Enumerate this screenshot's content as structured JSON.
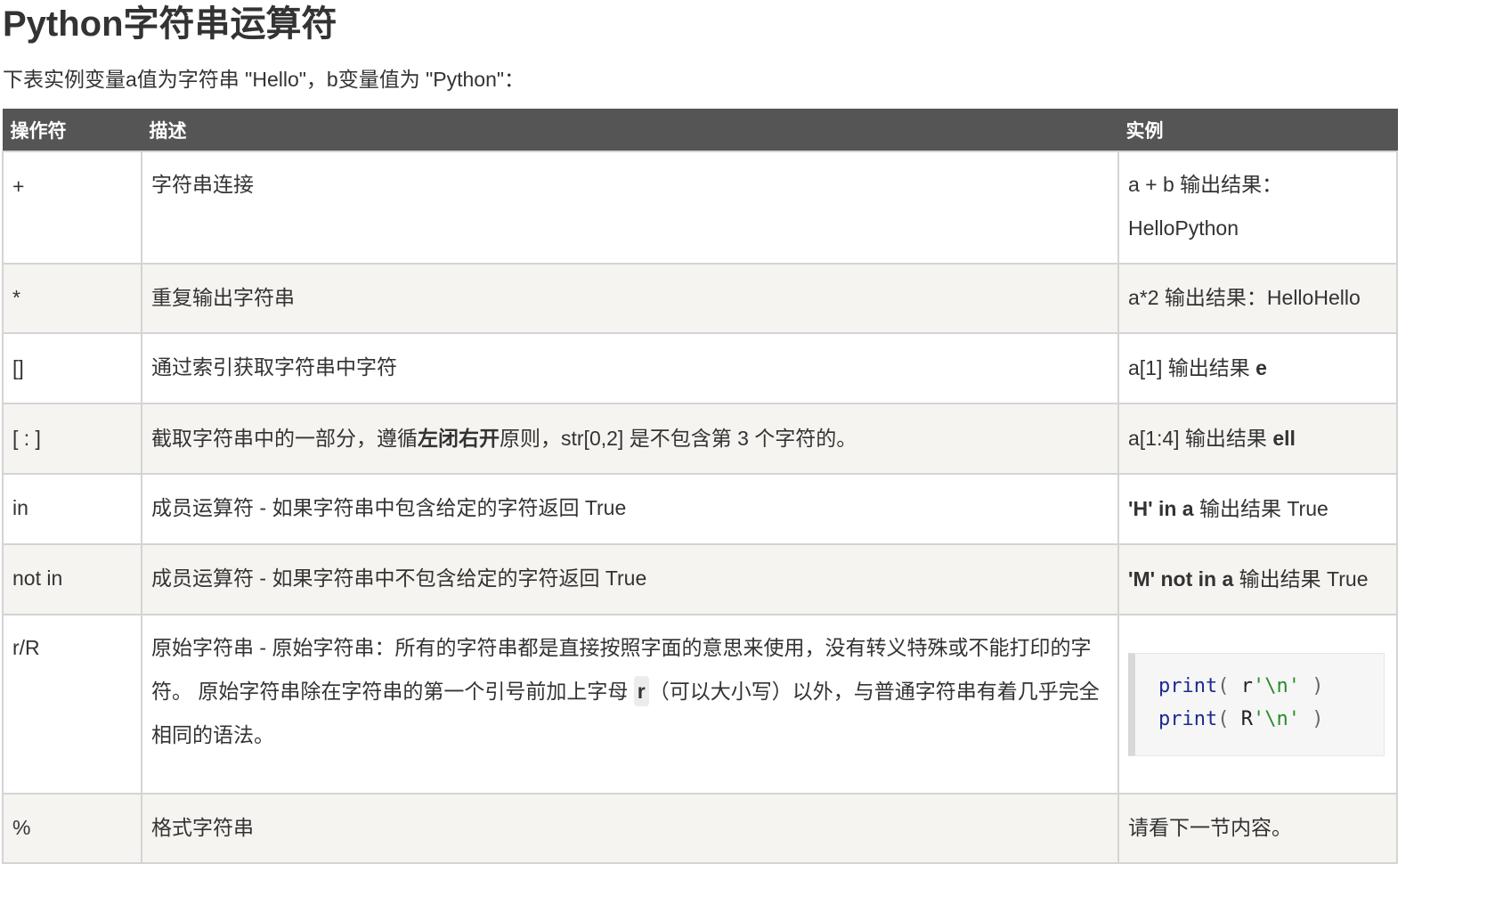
{
  "page": {
    "title": "Python字符串运算符",
    "intro": "下表实例变量a值为字符串 \"Hello\"，b变量值为 \"Python\"："
  },
  "table": {
    "headers": [
      "操作符",
      "描述",
      "实例"
    ],
    "rows": [
      {
        "op": "+",
        "desc": "字符串连接",
        "ex_line1": "a + b 输出结果：",
        "ex_line2": "HelloPython"
      },
      {
        "op": "*",
        "desc": "重复输出字符串",
        "example": "a*2 输出结果：HelloHello"
      },
      {
        "op": "[]",
        "desc": "通过索引获取字符串中字符",
        "ex_text": "a[1] 输出结果 ",
        "ex_bold": "e"
      },
      {
        "op": "[ : ]",
        "desc_a": "截取字符串中的一部分，遵循",
        "desc_bold": "左闭右开",
        "desc_b": "原则，str[0,2] 是不包含第 3 个字符的。",
        "ex_text": "a[1:4] 输出结果 ",
        "ex_bold": "ell"
      },
      {
        "op": "in",
        "desc": "成员运算符 - 如果字符串中包含给定的字符返回 True",
        "ex_bold": "'H' in a",
        "ex_text": " 输出结果 True"
      },
      {
        "op": "not in",
        "desc": "成员运算符 - 如果字符串中不包含给定的字符返回 True",
        "ex_bold": "'M' not in a",
        "ex_text": " 输出结果 True"
      },
      {
        "op": "r/R",
        "desc_a": "原始字符串 - 原始字符串：所有的字符串都是直接按照字面的意思来使用，没有转义特殊或不能打印的字符。 原始字符串除在字符串的第一个引号前加上字母 ",
        "desc_code": "r",
        "desc_b": "（可以大小写）以外，与普通字符串有着几乎完全相同的语法。",
        "code": [
          {
            "fn": "print",
            "open": "(",
            "prefix": "r",
            "str": "'\\n'",
            "close": ")"
          },
          {
            "fn": "print",
            "open": "(",
            "prefix": "R",
            "str": "'\\n'",
            "close": ")"
          }
        ]
      },
      {
        "op": "%",
        "desc": "格式字符串",
        "example": "请看下一节内容。"
      }
    ]
  }
}
